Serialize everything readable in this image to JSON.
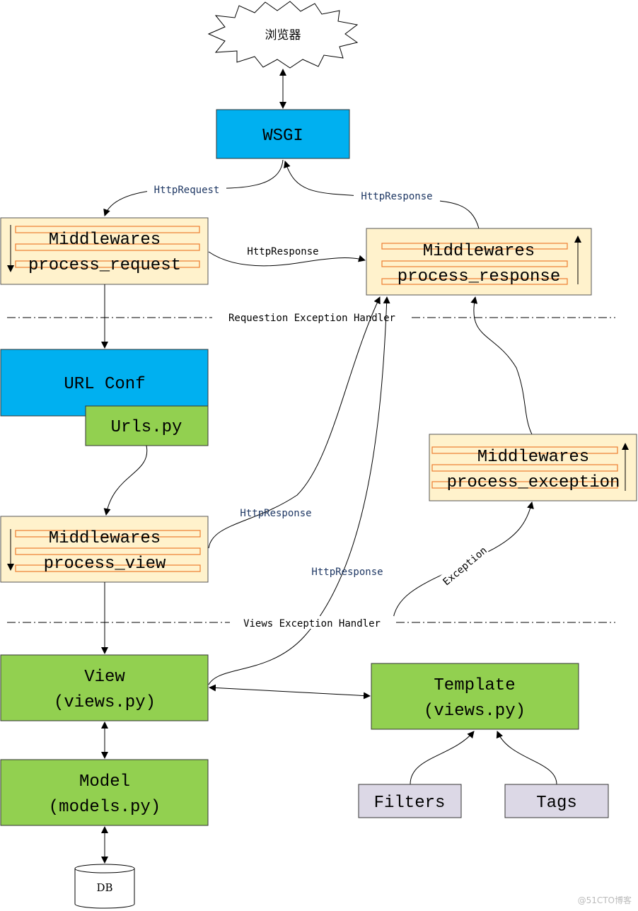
{
  "browser": "浏览器",
  "wsgi": "WSGI",
  "mw_request": {
    "line1": "Middlewares",
    "line2": "process_request"
  },
  "mw_response": {
    "line1": "Middlewares",
    "line2": "process_response"
  },
  "mw_view": {
    "line1": "Middlewares",
    "line2": "process_view"
  },
  "mw_exception": {
    "line1": "Middlewares",
    "line2": "process_exception"
  },
  "url_conf": "URL Conf",
  "urls_py": "Urls.py",
  "view": {
    "line1": "View",
    "line2": "(views.py)"
  },
  "template": {
    "line1": "Template",
    "line2": "(views.py)"
  },
  "model": {
    "line1": "Model",
    "line2": "(models.py)"
  },
  "filters": "Filters",
  "tags": "Tags",
  "db": "DB",
  "edges": {
    "http_request": "HttpRequest",
    "http_response_top": "HttpResponse",
    "http_response_mid": "HttpResponse",
    "http_response_view": "HttpResponse",
    "http_response_viewfn": "HttpResponse",
    "exception": "Exception"
  },
  "separators": {
    "request_handler": "Requestion Exception Handler",
    "views_handler": "Views Exception Handler"
  },
  "watermark": "@51CTO博客",
  "colors": {
    "blue": "#00B0F0",
    "green": "#92D050",
    "middleware": "#FFF2CC",
    "bar": "#ED7D31",
    "lavender": "#DCD8E6",
    "label": "#1F3864"
  }
}
